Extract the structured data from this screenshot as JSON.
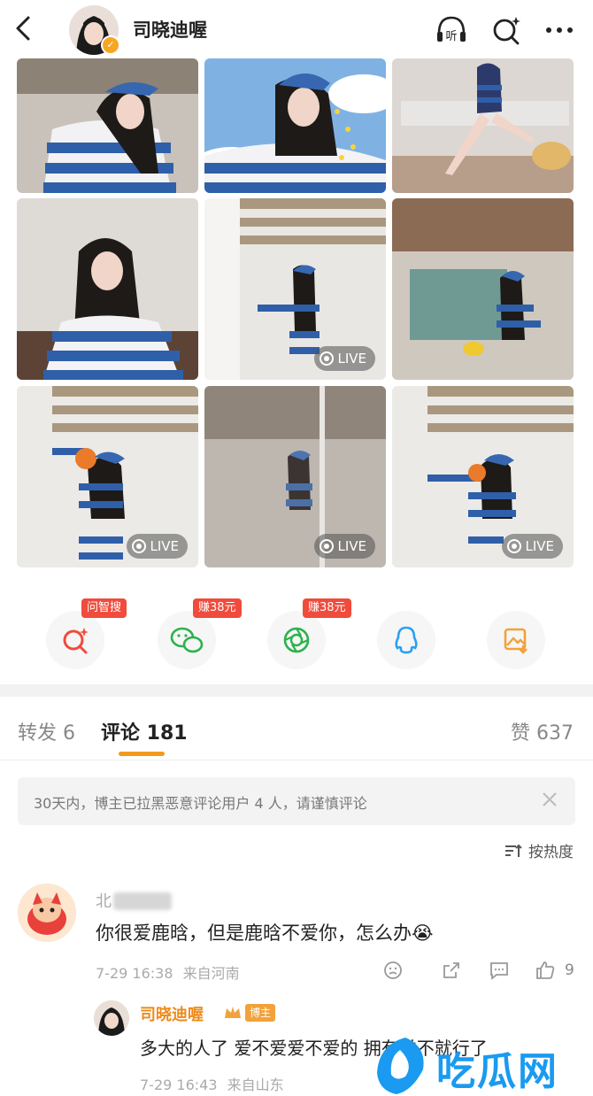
{
  "header": {
    "title": "司晓迪喔",
    "icons": [
      "back-icon",
      "listen-icon",
      "search-ai-icon",
      "more-icon"
    ],
    "listen_label": "听"
  },
  "photos": [
    {
      "live": false
    },
    {
      "live": false
    },
    {
      "live": false
    },
    {
      "live": false
    },
    {
      "live": true,
      "label": "LIVE"
    },
    {
      "live": false
    },
    {
      "live": true,
      "label": "LIVE"
    },
    {
      "live": true,
      "label": "LIVE"
    },
    {
      "live": true,
      "label": "LIVE"
    }
  ],
  "share": {
    "items": [
      {
        "icon": "zhisou-icon",
        "tag": "问智搜"
      },
      {
        "icon": "wechat-icon",
        "tag": "赚38元"
      },
      {
        "icon": "moments-icon",
        "tag": "赚38元"
      },
      {
        "icon": "qq-icon",
        "tag": ""
      },
      {
        "icon": "save-image-icon",
        "tag": ""
      }
    ]
  },
  "tabs": {
    "repost": "转发 6",
    "comments": "评论 181",
    "likes": "赞 637"
  },
  "notice": "30天内，博主已拉黑恶意评论用户 4 人，请谨慎评论",
  "sort_label": "按热度",
  "comment": {
    "name": "北",
    "text": "你很爱鹿晗，但是鹿晗不爱你，怎么办😭",
    "time": "7-29 16:38",
    "location": "来自河南",
    "likes": "9"
  },
  "reply": {
    "name": "司晓迪喔",
    "badge": "博主",
    "text": "多大的人了 爱不爱爱不爱的 拥有过不就行了",
    "time": "7-29 16:43",
    "location": "来自山东"
  },
  "watermark": "吃瓜网",
  "colors": {
    "accent": "#f39a1c",
    "tag_red": "#f04b3c",
    "watermark_blue": "#1a9af0"
  }
}
